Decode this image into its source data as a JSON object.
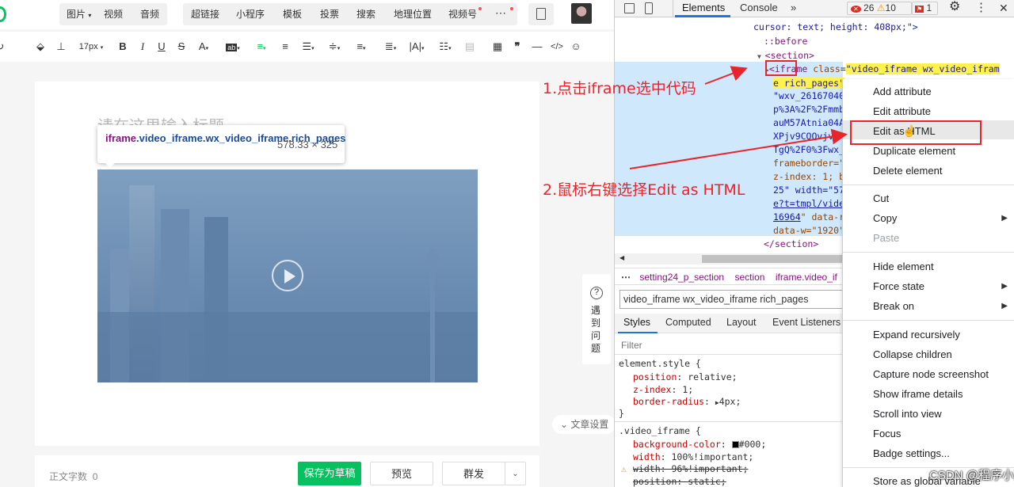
{
  "editor": {
    "toolbar": {
      "image": "图片",
      "video": "视频",
      "audio": "音频",
      "hyperlink": "超链接",
      "miniprogram": "小程序",
      "template": "模板",
      "vote": "投票",
      "search": "搜索",
      "location": "地理位置",
      "channels": "视频号"
    },
    "format": {
      "font_size": "17px"
    },
    "title_placeholder": "请在这里输入标题",
    "help_label": "遇到问题",
    "article_settings": "文章设置",
    "word_count_label": "正文字数",
    "word_count": "0",
    "buttons": {
      "save_draft": "保存为草稿",
      "preview": "预览",
      "mass_send": "群发"
    }
  },
  "tooltip": {
    "tag": "iframe",
    "classes": ".video_iframe.wx_video_iframe.rich_pages",
    "size": "578.33 × 325"
  },
  "devtools": {
    "tabs": [
      "Elements",
      "Console"
    ],
    "errors": "26",
    "warnings": "10",
    "issues": "1",
    "dom": {
      "line1": "cursor: text; height: 408px;\">",
      "before": "::before",
      "section_open": "<section>",
      "iframe_tag": "<iframe",
      "class_attr": "class",
      "class_value_1": "\"video_iframe wx_video_ifram",
      "class_value_2": "e rich_pages\"",
      "lines": [
        "\"wxv_26167040",
        "p%3A%2F%2Fmmb",
        "auM57Atnia04A",
        "XPjv9CQQvjvt",
        "TgQ%2F0%3Fwx_",
        "frameborder=\"",
        "z-index: 1; b",
        "25\" width=\"57",
        "e?t=tmpl/vide",
        "16964",
        "\" data-r",
        "data-w=\"1920\""
      ],
      "section_close": "</section>"
    },
    "breadcrumb": [
      "setting24_p_section",
      "section",
      "iframe.video_if"
    ],
    "class_edit": "video_iframe wx_video_iframe rich_pages",
    "style_tabs": [
      "Styles",
      "Computed",
      "Layout",
      "Event Listeners"
    ],
    "filter_placeholder": "Filter",
    "styles": {
      "rule1_selector": "element.style {",
      "rule1": [
        {
          "prop": "position",
          "val": "relative"
        },
        {
          "prop": "z-index",
          "val": "1"
        },
        {
          "prop": "border-radius",
          "val": "4px"
        }
      ],
      "rule2_selector": ".video_iframe {",
      "rule2": [
        {
          "prop": "background-color",
          "val": "#000"
        },
        {
          "prop": "width",
          "val": "100%!important"
        },
        {
          "prop": "width",
          "val": "96%!important"
        },
        {
          "prop": "position",
          "val": "static"
        }
      ]
    }
  },
  "menu": [
    "Add attribute",
    "Edit attribute",
    "Edit as HTML",
    "Duplicate element",
    "Delete element",
    "Cut",
    "Copy",
    "Paste",
    "Hide element",
    "Force state",
    "Break on",
    "Expand recursively",
    "Collapse children",
    "Capture node screenshot",
    "Show iframe details",
    "Scroll into view",
    "Focus",
    "Badge settings...",
    "Store as global variable"
  ],
  "annotations": {
    "step1": "1.点击iframe选中代码",
    "step2": "2.鼠标右键选择Edit as HTML"
  },
  "watermark": "CSDN @程序小菜鸟"
}
